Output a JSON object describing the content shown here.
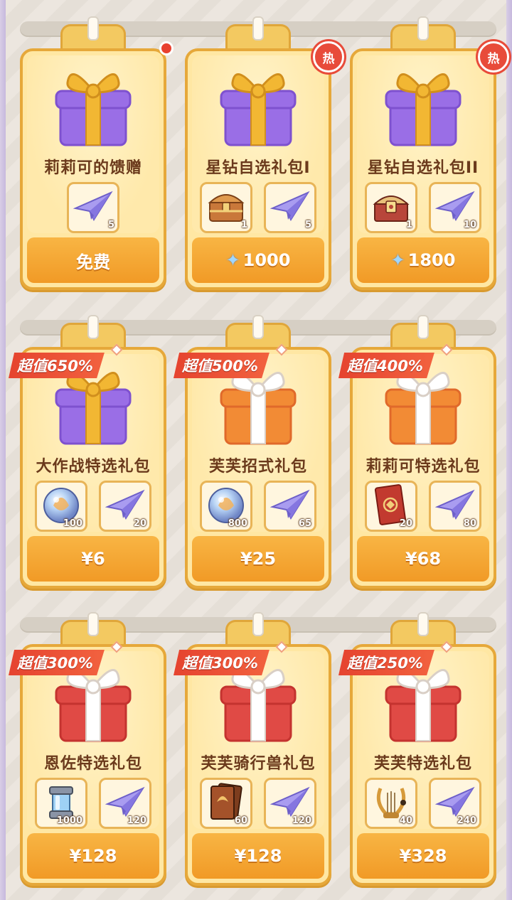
{
  "colors": {
    "accent": "#f19a26",
    "badge": "#e5432f",
    "hot": "#e84b3a"
  },
  "rows": [
    {
      "cards": [
        {
          "title": "莉莉可的馈赠",
          "price": "免费",
          "price_icon": "",
          "badge": "",
          "corner": "dot",
          "gift": "purple",
          "items": [
            {
              "icon": "paper-plane-icon",
              "qty": "5"
            }
          ]
        },
        {
          "title": "星钻自选礼包I",
          "price": "1000",
          "price_icon": "star-diamond-icon",
          "badge": "",
          "corner": "热",
          "gift": "purple",
          "items": [
            {
              "icon": "treasure-chest-icon",
              "qty": "1"
            },
            {
              "icon": "paper-plane-icon",
              "qty": "5"
            }
          ]
        },
        {
          "title": "星钻自选礼包II",
          "price": "1800",
          "price_icon": "star-diamond-icon",
          "badge": "",
          "corner": "热",
          "gift": "purple",
          "items": [
            {
              "icon": "ornate-chest-icon",
              "qty": "1"
            },
            {
              "icon": "paper-plane-icon",
              "qty": "10"
            }
          ]
        }
      ]
    },
    {
      "cards": [
        {
          "title": "大作战特选礼包",
          "price": "¥6",
          "price_icon": "",
          "badge": "超值650%",
          "corner": "",
          "gift": "purple",
          "items": [
            {
              "icon": "crystal-orb-icon",
              "qty": "100"
            },
            {
              "icon": "paper-plane-icon",
              "qty": "20"
            }
          ]
        },
        {
          "title": "芙芙招式礼包",
          "price": "¥25",
          "price_icon": "",
          "badge": "超值500%",
          "corner": "",
          "gift": "orange",
          "items": [
            {
              "icon": "crystal-orb-icon",
              "qty": "800"
            },
            {
              "icon": "paper-plane-icon",
              "qty": "65"
            }
          ]
        },
        {
          "title": "莉莉可特选礼包",
          "price": "¥68",
          "price_icon": "",
          "badge": "超值400%",
          "corner": "",
          "gift": "orange",
          "items": [
            {
              "icon": "red-card-icon",
              "qty": "20"
            },
            {
              "icon": "paper-plane-icon",
              "qty": "80"
            }
          ]
        }
      ]
    },
    {
      "cards": [
        {
          "title": "恩佐特选礼包",
          "price": "¥128",
          "price_icon": "",
          "badge": "超值300%",
          "corner": "",
          "gift": "red",
          "items": [
            {
              "icon": "gear-capsule-icon",
              "qty": "1000"
            },
            {
              "icon": "paper-plane-icon",
              "qty": "120"
            }
          ]
        },
        {
          "title": "芙芙骑行兽礼包",
          "price": "¥128",
          "price_icon": "",
          "badge": "超值300%",
          "corner": "",
          "gift": "red",
          "items": [
            {
              "icon": "brown-card-icon",
              "qty": "60"
            },
            {
              "icon": "paper-plane-icon",
              "qty": "120"
            }
          ]
        },
        {
          "title": "芙芙特选礼包",
          "price": "¥328",
          "price_icon": "",
          "badge": "超值250%",
          "corner": "",
          "gift": "red",
          "items": [
            {
              "icon": "lyre-icon",
              "qty": "40"
            },
            {
              "icon": "paper-plane-icon",
              "qty": "240"
            }
          ]
        }
      ]
    }
  ]
}
